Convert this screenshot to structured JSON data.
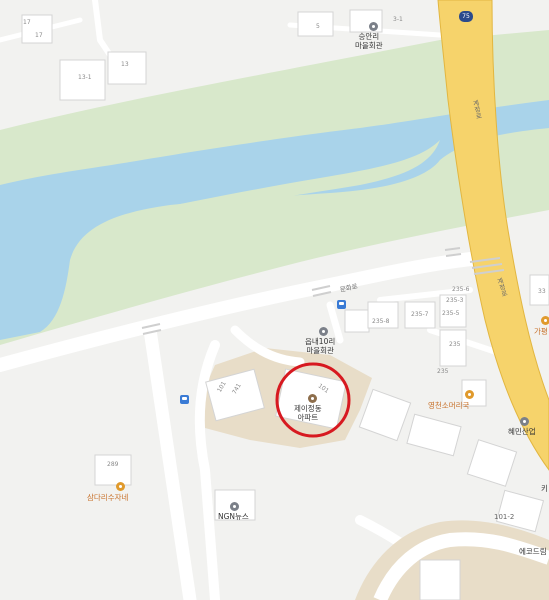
{
  "route_shield": "75",
  "roads": {
    "gyejeong_ro_top": "계정로",
    "gyejeong_ro_bottom": "계정로",
    "munhwa_ro": "문화로"
  },
  "pois": {
    "seungan_hall": "승안리\n마을회관",
    "eumnae_hall": "읍내10리\n마을회관",
    "apartment": "제이정동\n아파트",
    "yeongcheon_restaurant": "영천소머리국",
    "hyemin": "혜민산업",
    "samdari": "삼다리수자네",
    "ngn": "NGN뉴스",
    "gapyeong": "가평",
    "ekodeu": "에코드림",
    "ki": "키"
  },
  "building_numbers": {
    "b17a": "17",
    "b17b": "17",
    "b13_1": "13-1",
    "b13": "13",
    "b5": "5",
    "b3_1": "3-1",
    "b101_a": "101",
    "b741": "741",
    "b101_apt": "101",
    "b235_6": "235-6",
    "b235_3": "235-3",
    "b235_8": "235-8",
    "b235_7": "235-7",
    "b235_5": "235-5",
    "b235": "235",
    "b235b": "235",
    "b289": "289",
    "b101_2": "101-2",
    "b33": "33"
  },
  "colors": {
    "background": "#f2f2f0",
    "river": "#a9d3ea",
    "grass": "#d8e8cb",
    "highway": "#f6d36b",
    "highway_edge": "#e2b640",
    "road": "#ffffff",
    "campus": "#e8ddc8",
    "highlight_circle": "#d71920"
  }
}
